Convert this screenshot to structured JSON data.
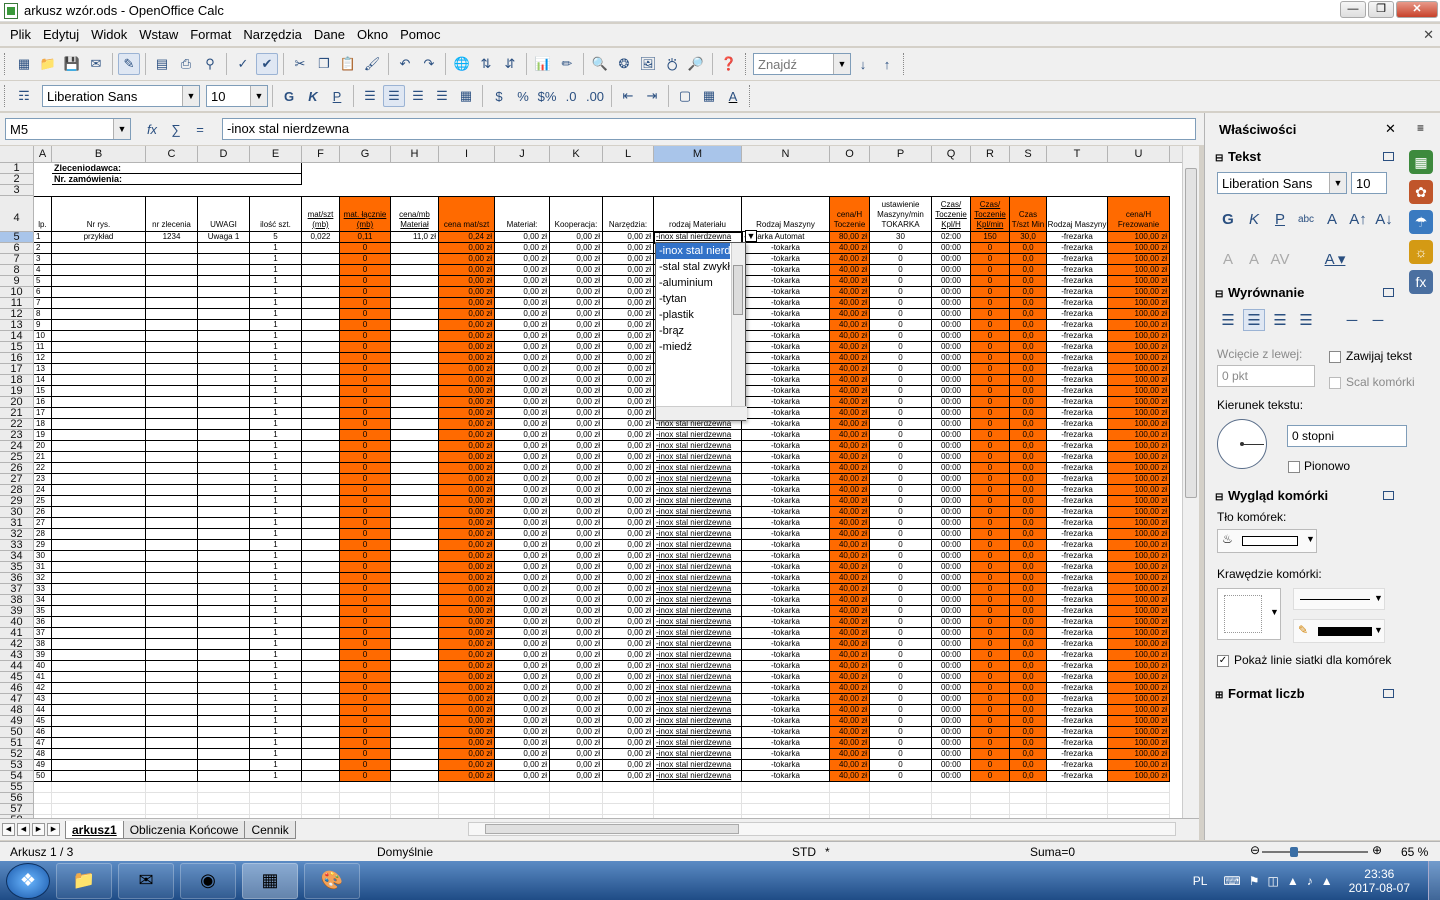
{
  "window": {
    "title": "arkusz wzór.ods - OpenOffice Calc",
    "minimize": "—",
    "maximize": "❐",
    "close": "✕"
  },
  "menu": [
    "Plik",
    "Edytuj",
    "Widok",
    "Wstaw",
    "Format",
    "Narzędzia",
    "Dane",
    "Okno",
    "Pomoc"
  ],
  "toolbar": {
    "find_placeholder": "Znajdź",
    "font_name": "Liberation Sans",
    "font_size": "10"
  },
  "formula": {
    "cell_ref": "M5",
    "content": "-inox stal nierdzewna",
    "fx": "fx",
    "sum": "∑",
    "eq": "="
  },
  "columns": [
    "A",
    "B",
    "C",
    "D",
    "E",
    "F",
    "G",
    "H",
    "I",
    "J",
    "K",
    "L",
    "M",
    "N",
    "O",
    "P",
    "Q",
    "R",
    "S",
    "T",
    "U"
  ],
  "selected_column": "M",
  "selected_row": 5,
  "colors": {
    "orange": "#ff6a00",
    "selection": "#3272c8"
  },
  "header_rows": {
    "r1_label": "Zleceniodawca:",
    "r2_label": "Nr. zamówienia:",
    "headers": {
      "A": "lp.",
      "B": "Nr rys.",
      "C": "nr zlecenia",
      "D": "UWAGI",
      "E": "ilość szt.",
      "F": "mat/szt (mb)",
      "G": "mat. łącznie (mb)",
      "H": "cena/mb Materiał",
      "I": "cena mat/szt",
      "J": "Materiał:",
      "K": "Kooperacja:",
      "L": "Narzędzia:",
      "M": "rodzaj Materiału",
      "N": "Rodzaj Maszyny",
      "O": "cena/H Toczenie",
      "P": "ustawienie Maszyny/min TOKARKA",
      "Q": "Czas/ Toczenie Kpl/H",
      "R": "Czas/ Toczenie Kpl/min",
      "S": "Czas T/szt Min",
      "T": "Rodzaj Maszyny",
      "U": "cena/H Frezowanie"
    }
  },
  "first_row": {
    "A": "1",
    "B": "przykład",
    "C": "1234",
    "D": "Uwaga 1",
    "E": "5",
    "F": "0,022",
    "G": "0,11",
    "H": "11,0 zł",
    "I": "0,24 zł",
    "J": "0,00 zł",
    "K": "0,00 zł",
    "L": "0,00 zł",
    "M": "-inox stal nierdzewna",
    "N": "-tokarka Automat",
    "O": "80,00 zł",
    "P": "30",
    "Q": "02:00",
    "R": "150",
    "S": "30,0",
    "T": "-frezarka",
    "U": "100,00 zł"
  },
  "data_row_template": {
    "E": "1",
    "G": "0",
    "I": "0,00 zł",
    "J": "0,00 zł",
    "K": "0,00 zł",
    "L": "0,00 zł",
    "M": "-inox stal nierdzewna",
    "N": "-tokarka",
    "O": "40,00 zł",
    "P": "0",
    "Q": "00:00",
    "R": "0",
    "S": "0,0",
    "T": "-frezarka",
    "U": "100,00 zł"
  },
  "data_row_count": 49,
  "dropdown": {
    "items": [
      "-inox stal nierdzewna",
      "-stal stal zwykła",
      "-aluminium",
      "-tytan",
      "-plastik",
      "-brąz",
      "-miedź"
    ],
    "selected": 0,
    "button": "▼"
  },
  "sheets": [
    "arkusz1",
    "Obliczenia Końcowe",
    "Cennik"
  ],
  "active_sheet": 0,
  "status": {
    "sheet_pos": "Arkusz 1 / 3",
    "page_style": "Domyślnie",
    "mode": "STD",
    "modified": "*",
    "sum": "Suma=0",
    "zoom": "65 %",
    "zoom_level_pct": 65
  },
  "sidebar": {
    "title": "Właściwości",
    "close": "✕",
    "menu": "≡",
    "sections": {
      "text": "Tekst",
      "alignment": "Wyrównanie",
      "appearance": "Wygląd komórki",
      "number_format": "Format liczb"
    },
    "font_name": "Liberation Sans",
    "font_size": "10",
    "indent_label": "Wcięcie z lewej:",
    "indent_value": "0 pkt",
    "wrap_label": "Zawijaj tekst",
    "merge_label": "Scal komórki",
    "direction_label": "Kierunek tekstu:",
    "direction_value": "0 stopni",
    "vertical_label": "Pionowo",
    "bg_label": "Tło komórek:",
    "border_label": "Krawędzie komórki:",
    "gridlines_label": "Pokaż linie siatki dla komórek",
    "gridlines_checked": true
  },
  "taskbar": {
    "lang": "PL",
    "time": "23:36",
    "date": "2017-08-07"
  }
}
